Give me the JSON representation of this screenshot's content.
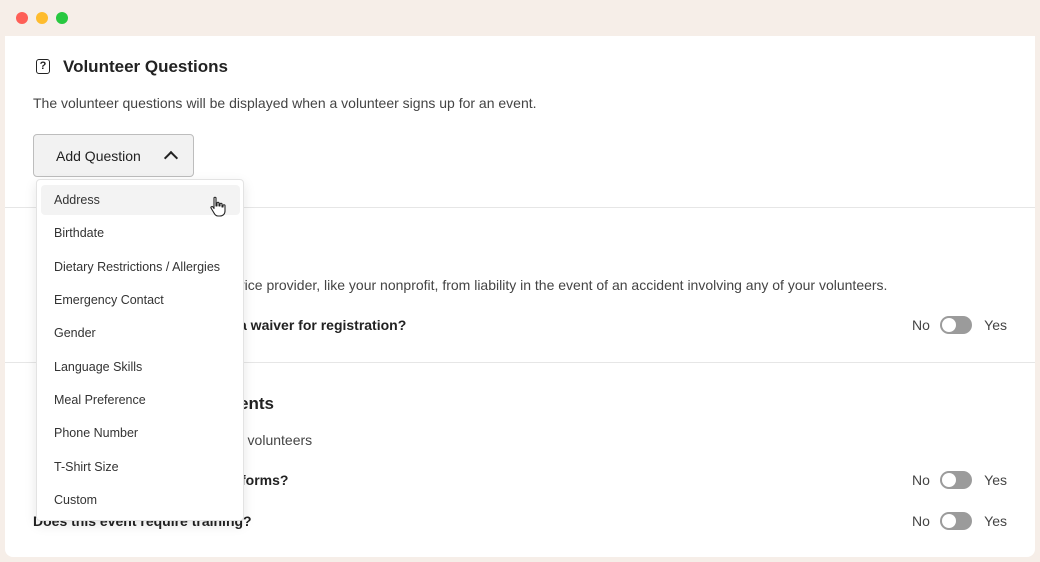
{
  "window": {
    "controls": [
      "close",
      "minimize",
      "maximize"
    ]
  },
  "volunteer_questions": {
    "title": "Volunteer Questions",
    "icon": "help-icon",
    "icon_glyph": "?",
    "description": "The volunteer questions will be displayed when a volunteer signs up for an event.",
    "add_button_label": "Add Question",
    "dropdown_open": true,
    "dropdown_items": [
      "Address",
      "Birthdate",
      "Dietary Restrictions / Allergies",
      "Emergency Contact",
      "Gender",
      "Language Skills",
      "Meal Preference",
      "Phone Number",
      "T-Shirt Size",
      "Custom"
    ],
    "hovered_item": "Address"
  },
  "waiver": {
    "description_visible": "rvice provider, like your nonprofit, from liability in the event of an accident involving any of your volunteers.",
    "question_visible": "a waiver for registration?",
    "toggle": {
      "no_label": "No",
      "yes_label": "Yes",
      "on": false
    }
  },
  "requirements": {
    "title_visible": "ents",
    "description_visible": "r volunteers",
    "questions": [
      {
        "text": "forms?",
        "no_label": "No",
        "yes_label": "Yes",
        "on": false
      },
      {
        "text": "Does this event require training?",
        "no_label": "No",
        "yes_label": "Yes",
        "on": false
      }
    ]
  },
  "colors": {
    "frame": "#f6eee8",
    "toggle_off": "#9b9b9b",
    "hover_bg": "#f3f3f3"
  }
}
